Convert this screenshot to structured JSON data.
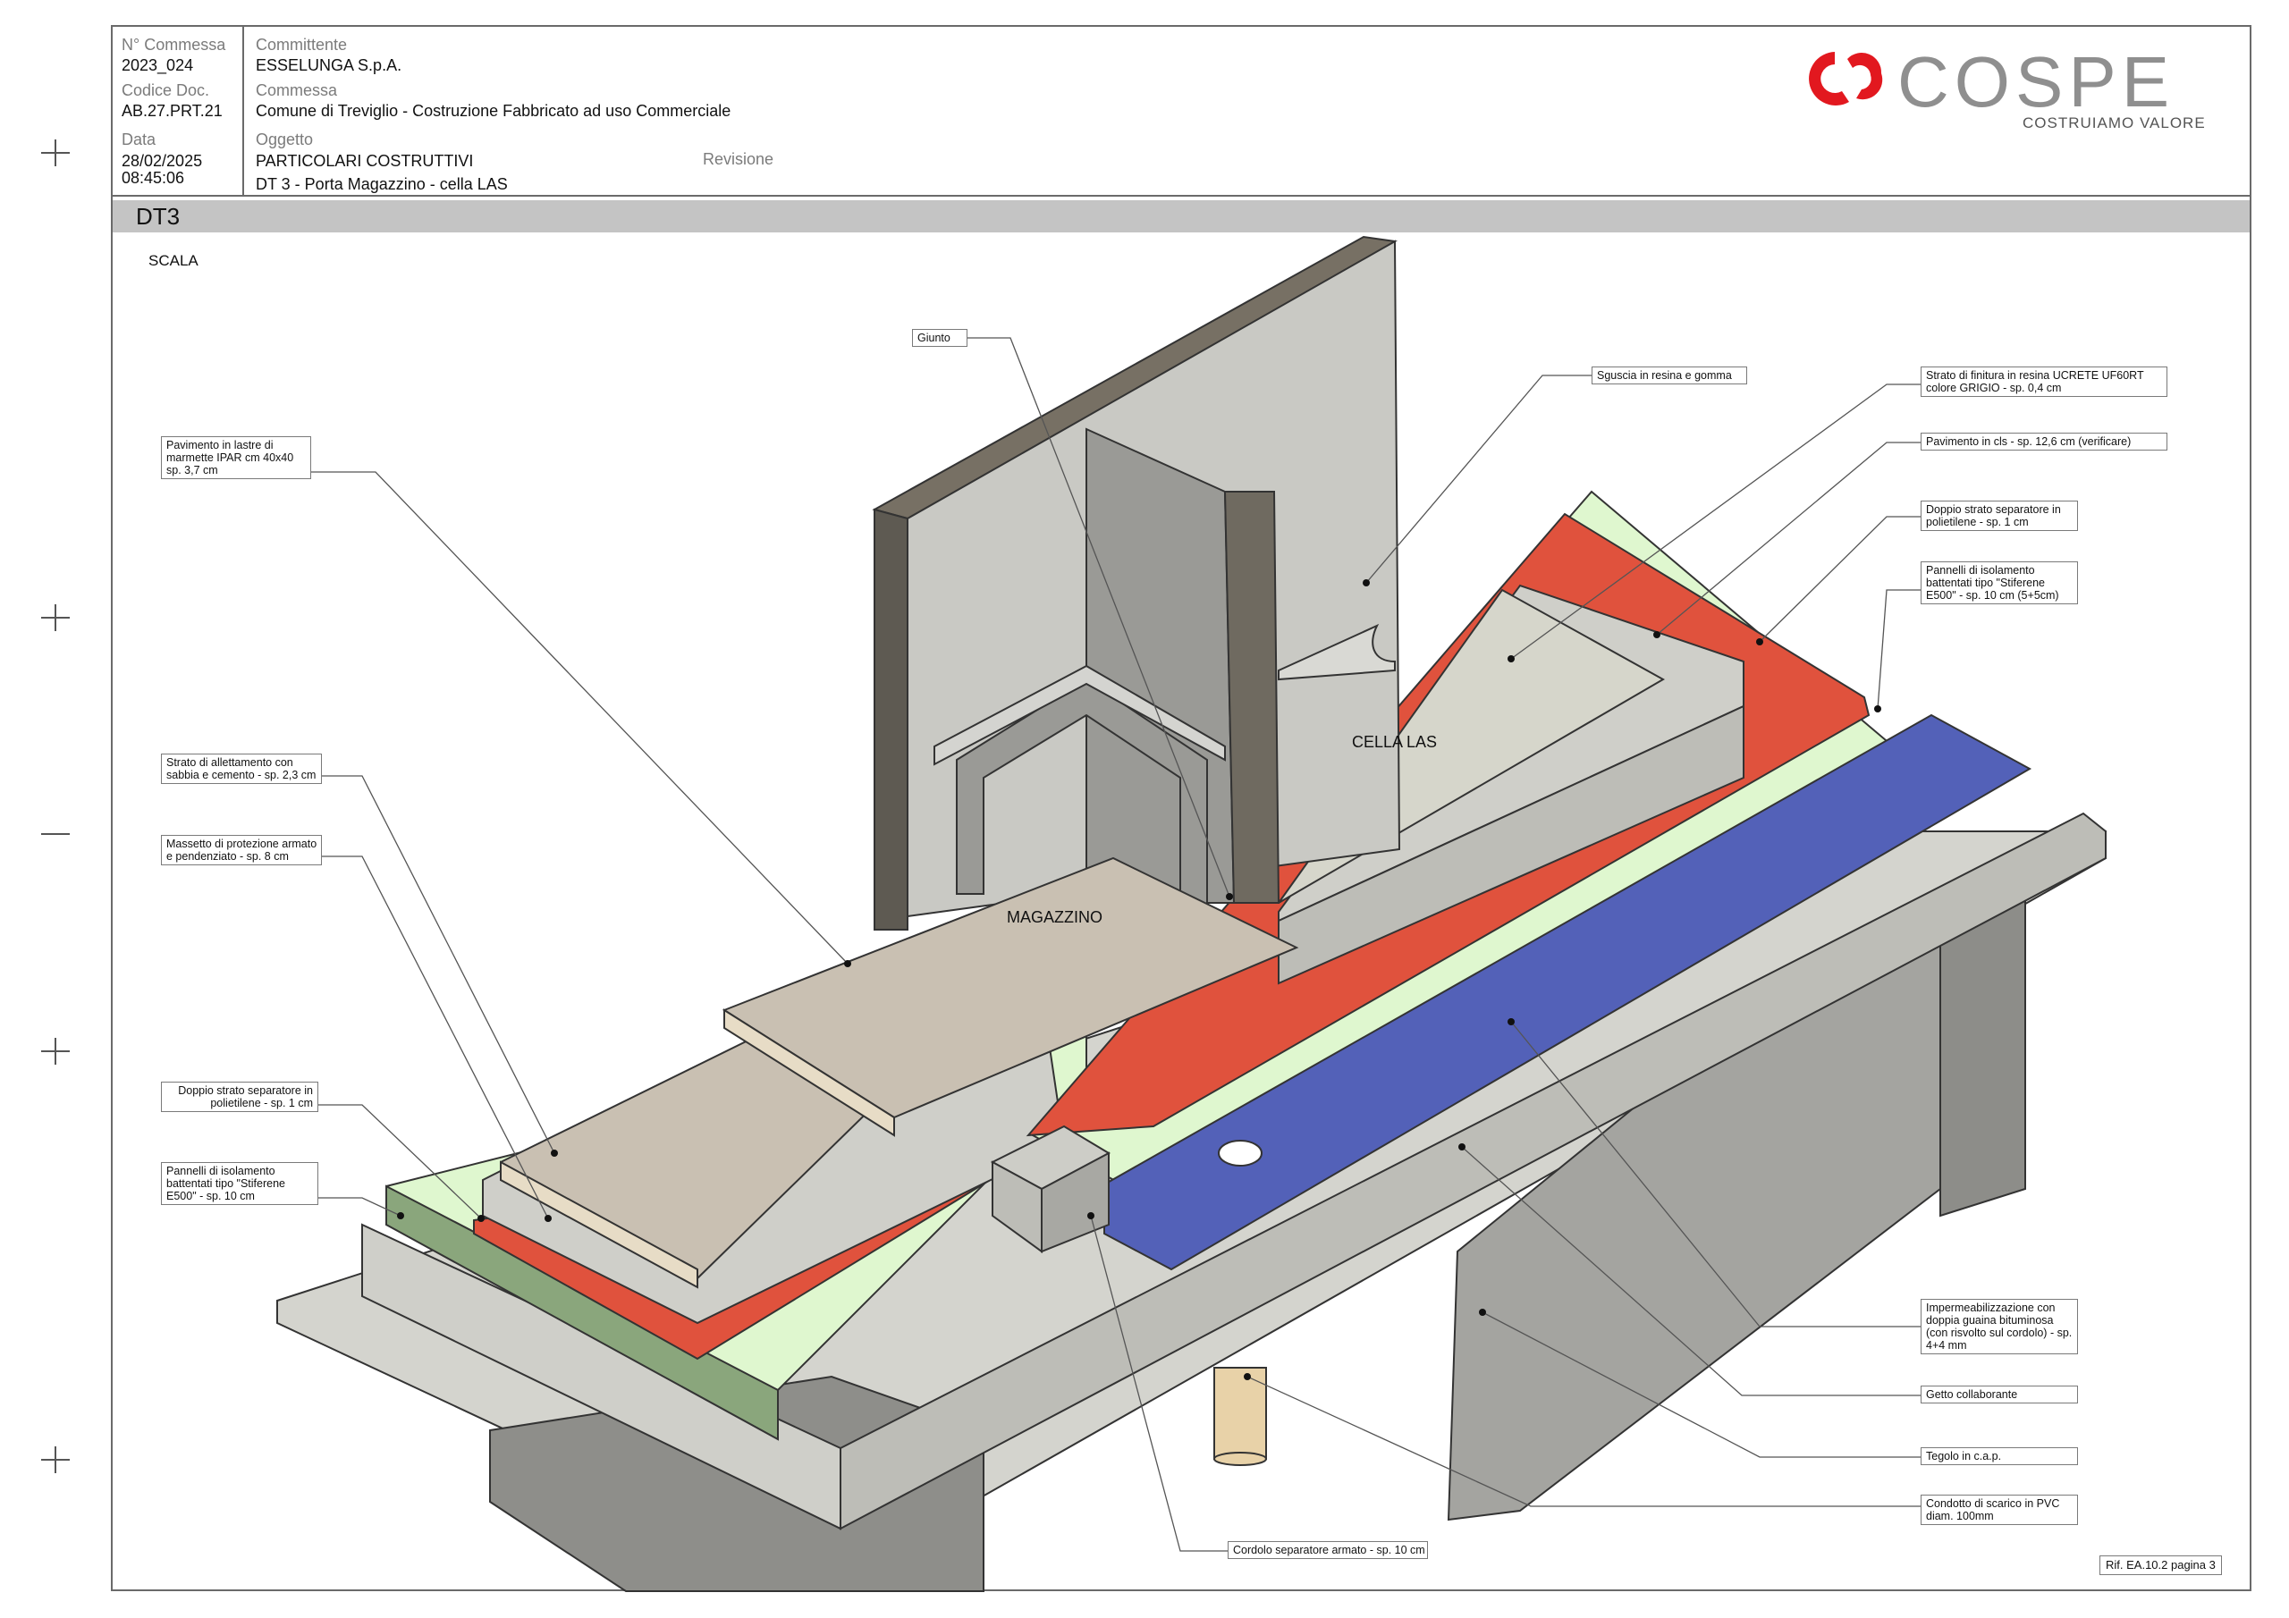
{
  "header": {
    "commessa_no_label": "N° Commessa",
    "commessa_no": "2023_024",
    "codice_doc_label": "Codice Doc.",
    "codice_doc": "AB.27.PRT.21",
    "data_label": "Data",
    "data": "28/02/2025",
    "ora": "08:45:06",
    "committente_label": "Committente",
    "committente": "ESSELUNGA S.p.A.",
    "commessa_label": "Commessa",
    "commessa": "Comune di Treviglio - Costruzione Fabbricato ad uso Commerciale",
    "oggetto_label": "Oggetto",
    "oggetto_1": "PARTICOLARI COSTRUTTIVI",
    "oggetto_2": "DT 3 - Porta Magazzino  - cella LAS",
    "revisione_label": "Revisione"
  },
  "logo": {
    "name": "COSPE",
    "tagline": "COSTRUIAMO VALORE",
    "color_red": "#e2181f",
    "color_grey": "#8f8f8f"
  },
  "band": {
    "title": "DT3"
  },
  "scala_label": "SCALA",
  "rooms": {
    "magazzino": "MAGAZZINO",
    "cella": "CELLA LAS"
  },
  "callouts": {
    "giunto": "Giunto",
    "pavimento_ipar": [
      "Pavimento in lastre di",
      "marmette IPAR cm 40x40",
      "sp. 3,7 cm"
    ],
    "strato_allettamento": [
      "Strato di allettamento con",
      "sabbia e cemento - sp. 2,3 cm"
    ],
    "massetto": [
      "Massetto di protezione armato",
      "e pendenziato - sp. 8 cm"
    ],
    "doppio_strato_sx": [
      "Doppio strato separatore in",
      "polietilene - sp. 1 cm"
    ],
    "pannelli_sx": [
      "Pannelli di isolamento",
      "battentati tipo \"Stiferene",
      "E500\" - sp. 10 cm"
    ],
    "sguscia": "Sguscia in resina e gomma",
    "strato_finitura": [
      "Strato di finitura in resina UCRETE UF60RT",
      "colore GRIGIO - sp. 0,4 cm"
    ],
    "pavimento_cls": "Pavimento in cls - sp. 12,6 cm (verificare)",
    "doppio_strato_dx": [
      "Doppio strato separatore in",
      "polietilene - sp. 1 cm"
    ],
    "pannelli_dx": [
      "Pannelli di isolamento",
      "battentati tipo \"Stiferene",
      "E500\" - sp. 10 cm (5+5cm)"
    ],
    "impermeabilizzazione": [
      "Impermeabilizzazione con",
      "doppia guaina bituminosa",
      "(con risvolto sul cordolo) - sp.",
      "4+4 mm"
    ],
    "getto": "Getto collaborante",
    "tegolo": "Tegolo in c.a.p.",
    "condotto": [
      "Condotto di scarico in PVC",
      "diam. 100mm"
    ],
    "cordolo": "Cordolo separatore armato - sp. 10 cm"
  },
  "reference": "Rif. EA.10.2 pagina 3",
  "colors": {
    "insulation_green": "#dff7cf",
    "insulation_green_dark": "#8aa67c",
    "separator_red": "#e0523d",
    "membrane_blue": "#5361b8",
    "concrete": "#cfcfc9",
    "tile": "#c9c0b2",
    "wall": "#c9c9c4",
    "pipe": "#e8d2a8"
  }
}
